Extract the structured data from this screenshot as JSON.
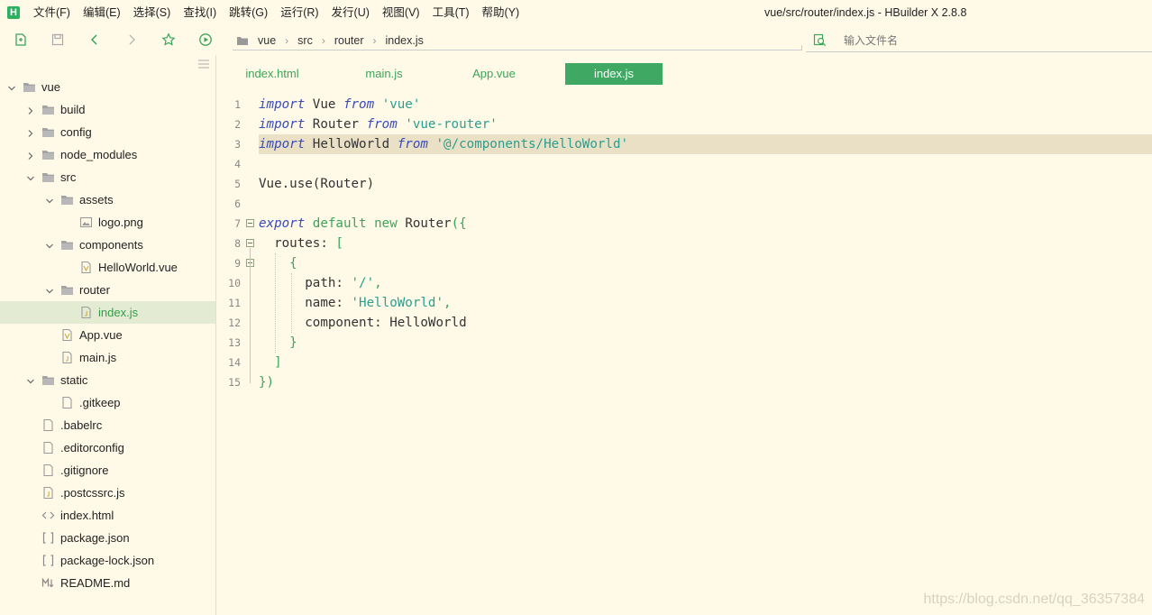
{
  "menu": {
    "items": [
      "文件(F)",
      "编辑(E)",
      "选择(S)",
      "查找(I)",
      "跳转(G)",
      "运行(R)",
      "发行(U)",
      "视图(V)",
      "工具(T)",
      "帮助(Y)"
    ],
    "window_title": "vue/src/router/index.js - HBuilder X 2.8.8",
    "logo_letter": "H"
  },
  "breadcrumb": [
    "vue",
    "src",
    "router",
    "index.js"
  ],
  "search": {
    "placeholder": "输入文件名"
  },
  "tree": [
    {
      "label": "vue",
      "type": "folder",
      "depth": 0,
      "expanded": true,
      "icon": "folder-icon"
    },
    {
      "label": "build",
      "type": "folder",
      "depth": 1,
      "expanded": false,
      "icon": "folder-icon"
    },
    {
      "label": "config",
      "type": "folder",
      "depth": 1,
      "expanded": false,
      "icon": "folder-icon"
    },
    {
      "label": "node_modules",
      "type": "folder",
      "depth": 1,
      "expanded": false,
      "icon": "folder-icon"
    },
    {
      "label": "src",
      "type": "folder",
      "depth": 1,
      "expanded": true,
      "icon": "folder-icon"
    },
    {
      "label": "assets",
      "type": "folder",
      "depth": 2,
      "expanded": true,
      "icon": "folder-icon"
    },
    {
      "label": "logo.png",
      "type": "file",
      "depth": 3,
      "icon": "image-file-icon"
    },
    {
      "label": "components",
      "type": "folder",
      "depth": 2,
      "expanded": true,
      "icon": "folder-icon"
    },
    {
      "label": "HelloWorld.vue",
      "type": "file",
      "depth": 3,
      "icon": "vue-file-icon"
    },
    {
      "label": "router",
      "type": "folder",
      "depth": 2,
      "expanded": true,
      "icon": "folder-icon"
    },
    {
      "label": "index.js",
      "type": "file",
      "depth": 3,
      "icon": "js-file-icon",
      "active": true
    },
    {
      "label": "App.vue",
      "type": "file",
      "depth": 2,
      "icon": "vue-file-icon"
    },
    {
      "label": "main.js",
      "type": "file",
      "depth": 2,
      "icon": "js-file-icon"
    },
    {
      "label": "static",
      "type": "folder",
      "depth": 1,
      "expanded": true,
      "icon": "folder-icon"
    },
    {
      "label": ".gitkeep",
      "type": "file",
      "depth": 2,
      "icon": "file-icon"
    },
    {
      "label": ".babelrc",
      "type": "file",
      "depth": 1,
      "icon": "file-icon"
    },
    {
      "label": ".editorconfig",
      "type": "file",
      "depth": 1,
      "icon": "file-icon"
    },
    {
      "label": ".gitignore",
      "type": "file",
      "depth": 1,
      "icon": "file-icon"
    },
    {
      "label": ".postcssrc.js",
      "type": "file",
      "depth": 1,
      "icon": "js-file-icon"
    },
    {
      "label": "index.html",
      "type": "file",
      "depth": 1,
      "icon": "html-file-icon"
    },
    {
      "label": "package.json",
      "type": "file",
      "depth": 1,
      "icon": "json-file-icon"
    },
    {
      "label": "package-lock.json",
      "type": "file",
      "depth": 1,
      "icon": "json-file-icon"
    },
    {
      "label": "README.md",
      "type": "file",
      "depth": 1,
      "icon": "markdown-file-icon"
    }
  ],
  "tabs": [
    {
      "label": "index.html",
      "active": false
    },
    {
      "label": "main.js",
      "active": false
    },
    {
      "label": "App.vue",
      "active": false
    },
    {
      "label": "index.js",
      "active": true
    }
  ],
  "code": [
    {
      "n": "1",
      "tokens": [
        [
          "kw-i",
          "import"
        ],
        [
          "",
          "Vue "
        ],
        [
          "kw-i",
          "from"
        ],
        [
          "str",
          "'vue'"
        ]
      ]
    },
    {
      "n": "2",
      "tokens": [
        [
          "kw-i",
          "import"
        ],
        [
          "",
          "Router "
        ],
        [
          "kw-i",
          "from"
        ],
        [
          "str",
          "'vue-router'"
        ]
      ]
    },
    {
      "n": "3",
      "tokens": [
        [
          "kw-i",
          "import"
        ],
        [
          "",
          "HelloWorld "
        ],
        [
          "kw-i",
          "from"
        ],
        [
          "str",
          "'@/components/HelloWorld'"
        ]
      ],
      "highlight": true
    },
    {
      "n": "4",
      "tokens": []
    },
    {
      "n": "5",
      "tokens": [
        [
          "",
          "Vue.use(Router)"
        ]
      ]
    },
    {
      "n": "6",
      "tokens": []
    },
    {
      "n": "7",
      "tokens": [
        [
          "kw-i",
          "export"
        ],
        [
          "kw",
          "default"
        ],
        [
          "kw",
          "new"
        ],
        [
          "",
          "Router"
        ],
        [
          "punc",
          "({"
        ]
      ],
      "fold": true
    },
    {
      "n": "8",
      "tokens": [
        [
          "",
          "  routes: "
        ],
        [
          "punc",
          "["
        ]
      ],
      "fold": true
    },
    {
      "n": "9",
      "tokens": [
        [
          "punc",
          "    {"
        ]
      ],
      "fold": true
    },
    {
      "n": "10",
      "tokens": [
        [
          "",
          "      path: "
        ],
        [
          "str",
          "'/'"
        ],
        [
          "punc",
          ","
        ]
      ]
    },
    {
      "n": "11",
      "tokens": [
        [
          "",
          "      name: "
        ],
        [
          "str",
          "'HelloWorld'"
        ],
        [
          "punc",
          ","
        ]
      ]
    },
    {
      "n": "12",
      "tokens": [
        [
          "",
          "      component: HelloWorld"
        ]
      ]
    },
    {
      "n": "13",
      "tokens": [
        [
          "punc",
          "    }"
        ]
      ]
    },
    {
      "n": "14",
      "tokens": [
        [
          "punc",
          "  ]"
        ]
      ]
    },
    {
      "n": "15",
      "tokens": [
        [
          "punc",
          "})"
        ]
      ]
    }
  ],
  "watermark": "https://blog.csdn.net/qq_36357384",
  "colors": {
    "accent": "#3fa862",
    "background": "#fffae8",
    "keyword": "#3a4bb8",
    "string": "#2b9e8f"
  }
}
